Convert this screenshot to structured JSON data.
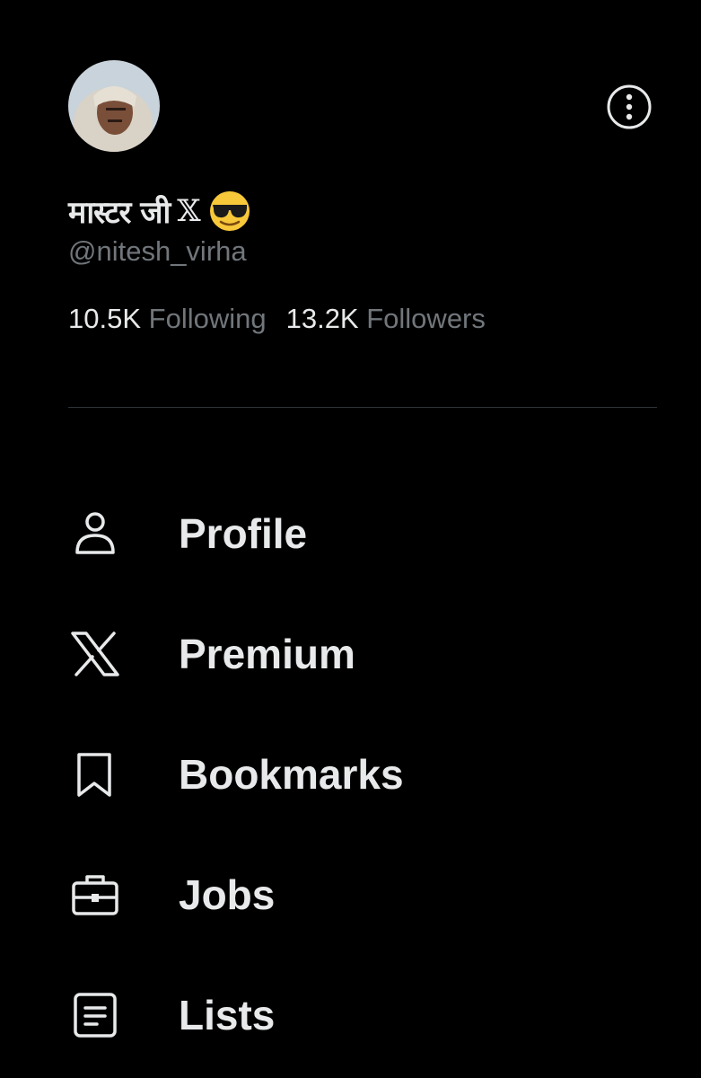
{
  "profile": {
    "display_name": "मास्टर जी",
    "verified_mark": "𝕏",
    "emoji": "sunglasses-emoji",
    "handle": "@nitesh_virha",
    "following_count": "10.5K",
    "following_label": "Following",
    "followers_count": "13.2K",
    "followers_label": "Followers"
  },
  "menu": [
    {
      "icon": "person-icon",
      "label": "Profile"
    },
    {
      "icon": "x-logo-icon",
      "label": "Premium"
    },
    {
      "icon": "bookmark-icon",
      "label": "Bookmarks"
    },
    {
      "icon": "briefcase-icon",
      "label": "Jobs"
    },
    {
      "icon": "list-icon",
      "label": "Lists"
    }
  ],
  "colors": {
    "background": "#000000",
    "primary_text": "#e7e9ea",
    "secondary_text": "#71767b",
    "divider": "#2f3336"
  }
}
